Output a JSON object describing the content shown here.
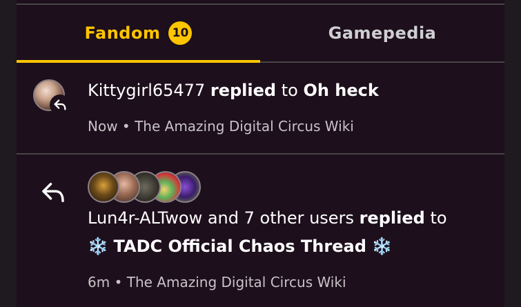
{
  "tabs": {
    "fandom": {
      "label": "Fandom",
      "badge": "10"
    },
    "gamepedia": {
      "label": "Gamepedia"
    }
  },
  "notifications": [
    {
      "user": "Kittygirl65477",
      "action": "replied",
      "connector": "to",
      "target": "Oh heck",
      "time": "Now",
      "separator": "•",
      "wiki": "The Amazing Digital Circus Wiki"
    },
    {
      "users_text": "Lun4r-ALTwow and 7 other users",
      "action": "replied",
      "connector": "to",
      "snowflake_left": "❄️",
      "target": "TADC Official Chaos Thread",
      "snowflake_right": "❄️",
      "time": "6m",
      "separator": "•",
      "wiki": "The Amazing Digital Circus Wiki"
    }
  ],
  "colors": {
    "accent": "#ffc500",
    "background": "#1d0f1b",
    "divider": "#4a4448",
    "meta_text": "#c9c3c8"
  },
  "icons": {
    "reply_small": "reply-arrow-icon",
    "reply_large": "reply-arrow-icon"
  }
}
